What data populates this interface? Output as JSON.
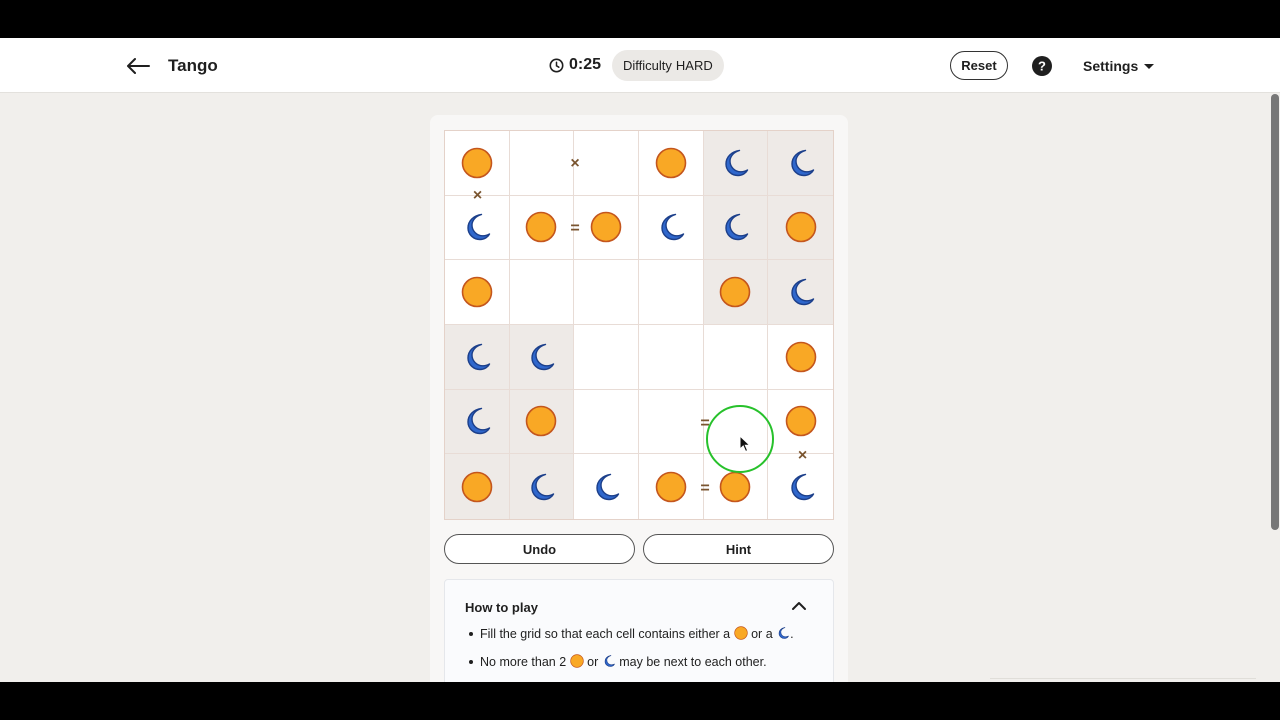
{
  "header": {
    "title": "Tango",
    "timer": "0:25",
    "difficulty_label": "Difficulty",
    "difficulty_value": "HARD",
    "reset_label": "Reset",
    "settings_label": "Settings"
  },
  "colors": {
    "sun": "#f9a825",
    "sun_border": "#c4561d",
    "moon": "#2f67cc",
    "moon_border": "#1c3f8a",
    "locked_cell": "#eeeae7",
    "constraint": "#7a5530",
    "click_ring": "#27c12b"
  },
  "board": {
    "rows": [
      [
        {
          "p": "sun",
          "locked": false
        },
        {
          "p": "",
          "locked": false
        },
        {
          "p": "",
          "locked": false
        },
        {
          "p": "sun",
          "locked": false
        },
        {
          "p": "moon",
          "locked": true
        },
        {
          "p": "moon",
          "locked": true
        }
      ],
      [
        {
          "p": "moon",
          "locked": false
        },
        {
          "p": "sun",
          "locked": false
        },
        {
          "p": "sun",
          "locked": false
        },
        {
          "p": "moon",
          "locked": false
        },
        {
          "p": "moon",
          "locked": true
        },
        {
          "p": "sun",
          "locked": true
        }
      ],
      [
        {
          "p": "sun",
          "locked": false
        },
        {
          "p": "",
          "locked": false
        },
        {
          "p": "",
          "locked": false
        },
        {
          "p": "",
          "locked": false
        },
        {
          "p": "sun",
          "locked": true
        },
        {
          "p": "moon",
          "locked": true
        }
      ],
      [
        {
          "p": "moon",
          "locked": true
        },
        {
          "p": "moon",
          "locked": true
        },
        {
          "p": "",
          "locked": false
        },
        {
          "p": "",
          "locked": false
        },
        {
          "p": "",
          "locked": false
        },
        {
          "p": "sun",
          "locked": false
        }
      ],
      [
        {
          "p": "moon",
          "locked": true
        },
        {
          "p": "sun",
          "locked": true
        },
        {
          "p": "",
          "locked": false
        },
        {
          "p": "",
          "locked": false
        },
        {
          "p": "",
          "locked": false
        },
        {
          "p": "sun",
          "locked": false
        }
      ],
      [
        {
          "p": "sun",
          "locked": true
        },
        {
          "p": "moon",
          "locked": true
        },
        {
          "p": "moon",
          "locked": false
        },
        {
          "p": "sun",
          "locked": false
        },
        {
          "p": "sun",
          "locked": false
        },
        {
          "p": "moon",
          "locked": false
        }
      ]
    ],
    "constraints": [
      {
        "type": "cross",
        "symbol": "×",
        "row": 0,
        "col": 1,
        "dir": "right"
      },
      {
        "type": "cross",
        "symbol": "×",
        "row": 0,
        "col": 0,
        "dir": "down"
      },
      {
        "type": "equal",
        "symbol": "=",
        "row": 1,
        "col": 1,
        "dir": "right"
      },
      {
        "type": "equal",
        "symbol": "=",
        "row": 4,
        "col": 3,
        "dir": "right"
      },
      {
        "type": "cross",
        "symbol": "×",
        "row": 4,
        "col": 5,
        "dir": "down"
      },
      {
        "type": "equal",
        "symbol": "=",
        "row": 5,
        "col": 3,
        "dir": "right"
      }
    ]
  },
  "actions": {
    "undo_label": "Undo",
    "hint_label": "Hint"
  },
  "how_to_play": {
    "title": "How to play",
    "rule1_pre": "Fill the grid so that each cell contains either a",
    "rule1_mid": "or a",
    "rule1_post": ".",
    "rule2_pre": "No more than 2",
    "rule2_mid": "or",
    "rule2_post": "may be next to each other."
  }
}
